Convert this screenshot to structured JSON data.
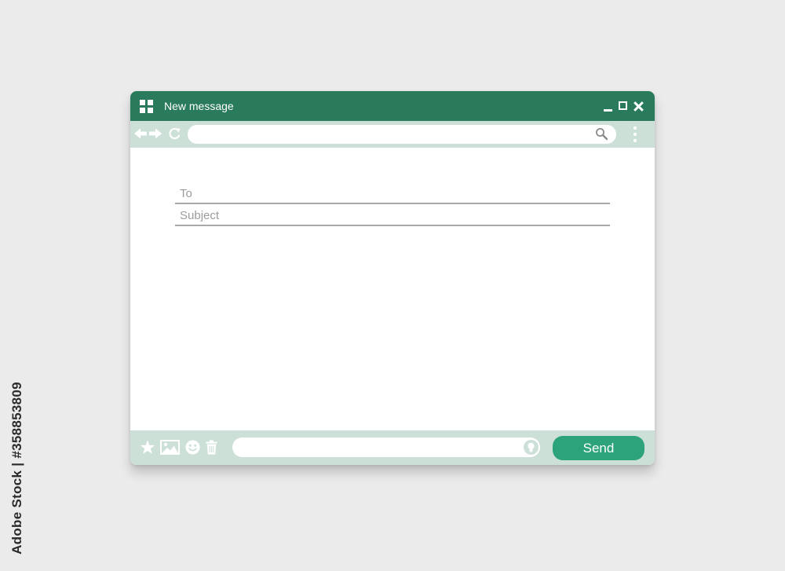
{
  "window": {
    "title": "New message"
  },
  "toolbar": {
    "url_value": ""
  },
  "compose": {
    "to_placeholder": "To",
    "to_value": "",
    "subject_placeholder": "Subject",
    "subject_value": "",
    "message_value": "",
    "send_label": "Send"
  },
  "watermark": {
    "side_text": "Adobe Stock | #358853809"
  },
  "icons": [
    "app-grid-icon",
    "minimize-icon",
    "maximize-icon",
    "close-icon",
    "back-arrow-icon",
    "forward-arrow-icon",
    "reload-icon",
    "search-icon",
    "more-vertical-icon",
    "star-icon",
    "image-icon",
    "emoji-icon",
    "trash-icon",
    "lightbulb-icon"
  ],
  "colors": {
    "titlebar": "#2a7a5c",
    "toolbar": "#cde0d8",
    "send_button": "#2ca37a",
    "background": "#ebebeb"
  }
}
